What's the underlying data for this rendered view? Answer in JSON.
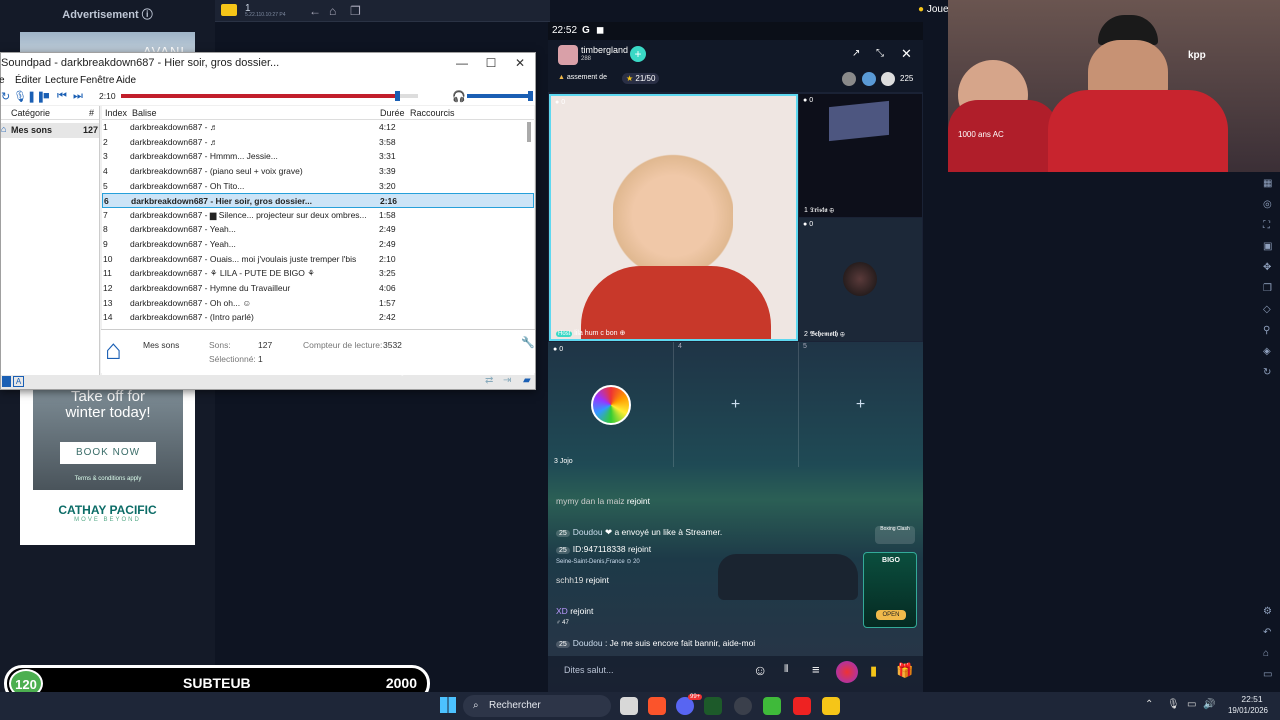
{
  "ad": {
    "label": "Advertisement ⓘ",
    "top_brand": "AVANI",
    "headline1": "Take off for",
    "headline2": "winter today!",
    "button": "BOOK NOW",
    "terms": "Terms & conditions apply",
    "brand": "CATHAY PACIFIC",
    "tagline": "MOVE BEYOND"
  },
  "browser": {
    "tab_number": "1",
    "ip": "5.22.110.10:27 P4",
    "right_label": "Joue"
  },
  "soundpad": {
    "title": "Soundpad - darkbreakdown687 - Hier soir, gros dossier...",
    "menu": [
      "Éditer",
      "Lecture",
      "Fenêtre",
      "Aide"
    ],
    "elapsed": "2:10",
    "progress": 0.93,
    "volume": 1.0,
    "cat_headers": {
      "name": "Catégorie",
      "count": "#"
    },
    "categories": [
      {
        "name": "Mes sons",
        "count": "127"
      }
    ],
    "list_headers": {
      "index": "Index",
      "tag": "Balise",
      "duration": "Durée",
      "shortcut": "Raccourcis"
    },
    "rows": [
      {
        "index": "1",
        "tag": "darkbreakdown687 - ♬",
        "duration": "4:12"
      },
      {
        "index": "2",
        "tag": "darkbreakdown687 - ♬",
        "duration": "3:58"
      },
      {
        "index": "3",
        "tag": "darkbreakdown687 - Hmmm... Jessie...",
        "duration": "3:31"
      },
      {
        "index": "4",
        "tag": "darkbreakdown687 - (piano seul + voix grave)",
        "duration": "3:39"
      },
      {
        "index": "5",
        "tag": "darkbreakdown687 - Oh Tito...",
        "duration": "3:20"
      },
      {
        "index": "6",
        "tag": "darkbreakdown687 - Hier soir, gros dossier...",
        "duration": "2:16"
      },
      {
        "index": "7",
        "tag": "darkbreakdown687 - ▆ Silence... projecteur sur deux ombres...",
        "duration": "1:58"
      },
      {
        "index": "8",
        "tag": "darkbreakdown687 - Yeah...",
        "duration": "2:49"
      },
      {
        "index": "9",
        "tag": "darkbreakdown687 - Yeah...",
        "duration": "2:49"
      },
      {
        "index": "10",
        "tag": "darkbreakdown687 - Ouais... moi j'voulais juste tremper l'bis",
        "duration": "2:10"
      },
      {
        "index": "11",
        "tag": "darkbreakdown687 - ⚘ LILA - PUTE DE BIGO ⚘",
        "duration": "3:25"
      },
      {
        "index": "12",
        "tag": "darkbreakdown687 - Hymne du Travailleur",
        "duration": "4:06"
      },
      {
        "index": "13",
        "tag": "darkbreakdown687 - Oh oh... ☺",
        "duration": "1:57"
      },
      {
        "index": "14",
        "tag": "darkbreakdown687 - (Intro parlé)",
        "duration": "2:42"
      }
    ],
    "selected_index": 5,
    "footer": {
      "category": "Mes sons",
      "sounds_label": "Sons:",
      "sounds": "127",
      "selected_label": "Sélectionné:",
      "selected": "1",
      "counter_label": "Compteur de lecture:",
      "counter": "3532"
    }
  },
  "live": {
    "time": "22:52",
    "host_name": "timbergland",
    "host_coins": "288",
    "room_label": "assement de",
    "room_count": "21/50",
    "viewers": "225",
    "tiles": [
      {
        "seat": "Host",
        "name": "lila hum c bon",
        "coins": "0"
      },
      {
        "seat": "1",
        "name": "𝕿𝖗𝖎𝖘𝖙𝖆",
        "coins": "0"
      },
      {
        "seat": "2",
        "name": "𝕭𝖊𝖍𝖊𝖒𝖔𝖙𝖍",
        "coins": "0"
      },
      {
        "seat": "3",
        "name": "Jojo",
        "coins": "0"
      },
      {
        "seat": "4",
        "name": ""
      },
      {
        "seat": "5",
        "name": ""
      }
    ],
    "chat": [
      {
        "user": "mymy dan la maiz",
        "text": "rejoint",
        "level": ""
      },
      {
        "user": "Doudou",
        "text": "a envoyé un like à Streamer.",
        "level": "25"
      },
      {
        "user": "ID:947118338",
        "text": "rejoint",
        "level": "25",
        "location": "Seine-Saint-Denis,France",
        "extra": "20"
      },
      {
        "user": "schh19",
        "text": "rejoint",
        "level": ""
      },
      {
        "user": "XD",
        "text": "rejoint",
        "level": "47"
      },
      {
        "user": "Doudou",
        "text": ": Je me suis encore fait bannir, aide-moi",
        "level": "25"
      }
    ],
    "input_placeholder": "Dites salut...",
    "promo_label": "Boxing Clash",
    "promo_button": "OPEN",
    "promo_brand": "BIGO"
  },
  "cam": {
    "shirt_text1": "1000 ans AC",
    "shirt_text2": "kpp"
  },
  "score": {
    "left": "120",
    "name": "SUBTEUB",
    "right": "2000"
  },
  "taskbar": {
    "search": "Rechercher",
    "time": "22:51",
    "date": "19/01/2026",
    "badge": "99+"
  },
  "colors": {
    "accent": "#1a5fb4",
    "progress": "#c21e2b",
    "tile_border": "#5ed8f0",
    "score_green": "#4caf50"
  }
}
